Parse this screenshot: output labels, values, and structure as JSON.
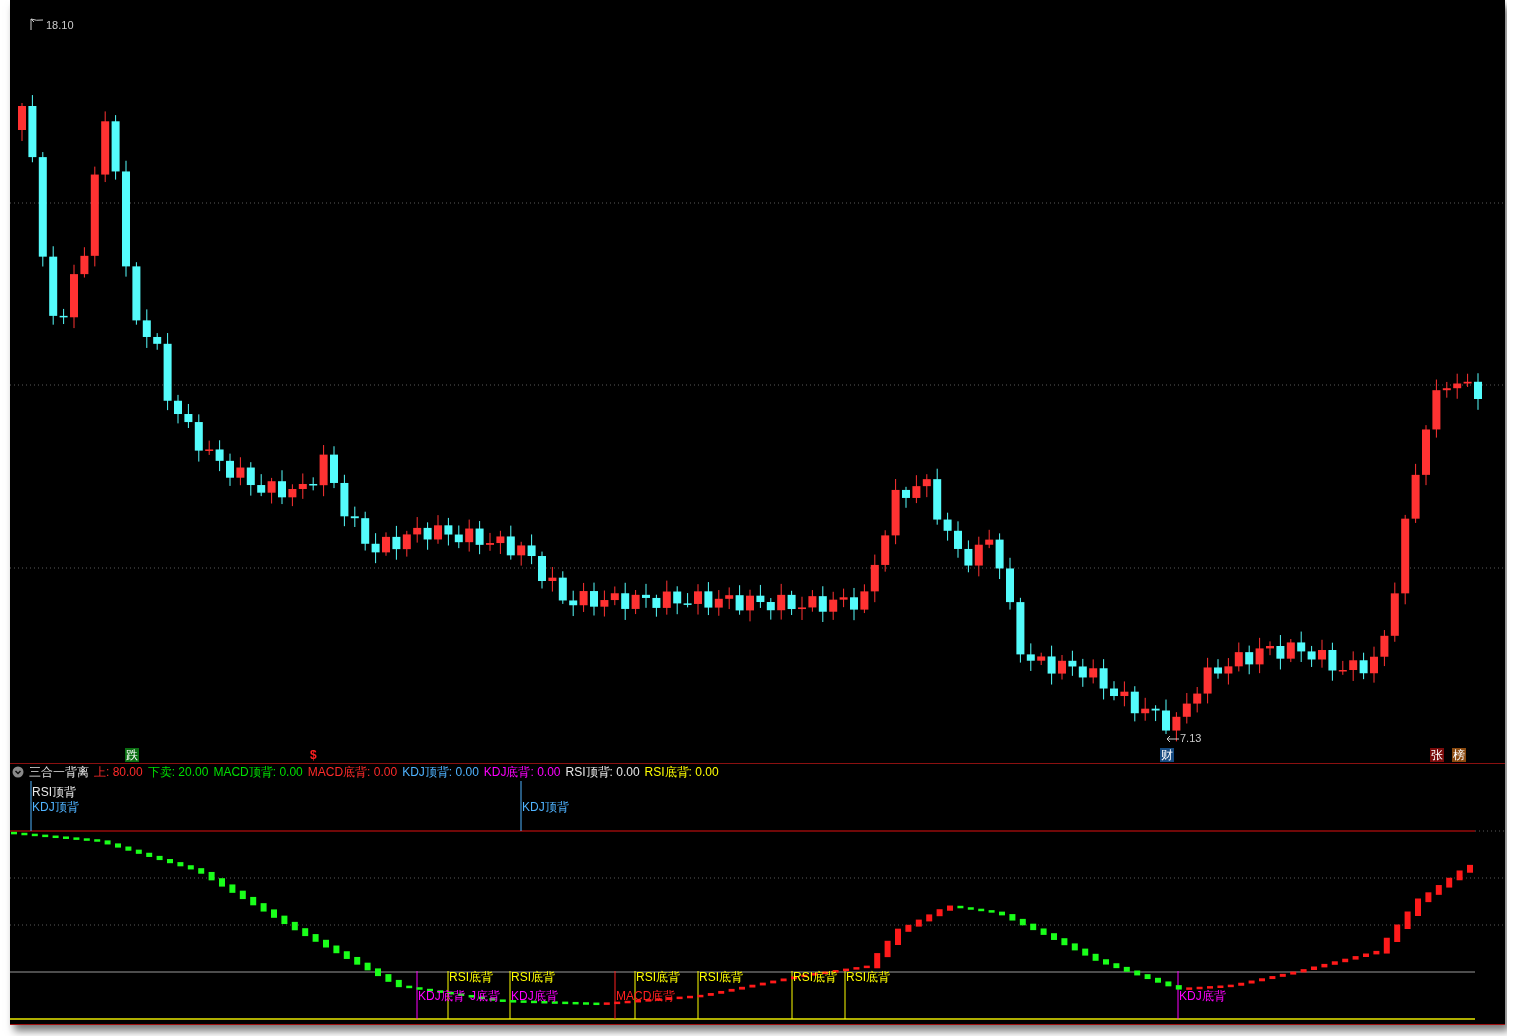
{
  "price_chart": {
    "high_label": "18.10",
    "low_label": "7.13",
    "markers": [
      {
        "text": "跌",
        "kind": "tag",
        "color": "#0b6e12"
      },
      {
        "text": "$",
        "kind": "glyph",
        "color": "#ff2020"
      },
      {
        "text": "财",
        "kind": "tag",
        "color": "#164a80"
      },
      {
        "text": "张",
        "kind": "tag",
        "color": "#7a0c0c"
      },
      {
        "text": "榜",
        "kind": "tag",
        "color": "#8a4a10"
      }
    ]
  },
  "indicator": {
    "title": "三合一背离",
    "params": [
      {
        "text": "上: 80.00",
        "color": "#ff2a2a"
      },
      {
        "text": "下卖: 20.00",
        "color": "#00e000"
      },
      {
        "text": "MACD顶背: 0.00",
        "color": "#00e000"
      },
      {
        "text": "MACD底背: 0.00",
        "color": "#ff2a2a"
      },
      {
        "text": "KDJ顶背: 0.00",
        "color": "#4fb3ff"
      },
      {
        "text": "KDJ底背: 0.00",
        "color": "#ff00ff"
      },
      {
        "text": "RSI顶背: 0.00",
        "color": "#e8e8e8"
      },
      {
        "text": "RSI底背: 0.00",
        "color": "#ffff00"
      }
    ],
    "signals": [
      {
        "text": "RSI顶背",
        "color": "#e8e8e8"
      },
      {
        "text": "KDJ顶背",
        "color": "#4fb3ff"
      },
      {
        "text": "KDJ顶背",
        "color": "#4fb3ff"
      },
      {
        "text": "KDJ底背",
        "color": "#ff00ff"
      },
      {
        "text": "J底背",
        "color": "#ff00ff"
      },
      {
        "text": "RSI底背",
        "color": "#ffff00"
      },
      {
        "text": "RSI底背",
        "color": "#ffff00"
      },
      {
        "text": "KDJ底背",
        "color": "#ff00ff"
      },
      {
        "text": "MACD底背",
        "color": "#ff2020"
      },
      {
        "text": "RSI底背",
        "color": "#ffff00"
      },
      {
        "text": "RSI底背",
        "color": "#ffff00"
      },
      {
        "text": "RSI底背",
        "color": "#ffff00"
      },
      {
        "text": "RSI底背",
        "color": "#ffff00"
      },
      {
        "text": "KDJ底背",
        "color": "#ff00ff"
      }
    ]
  }
}
